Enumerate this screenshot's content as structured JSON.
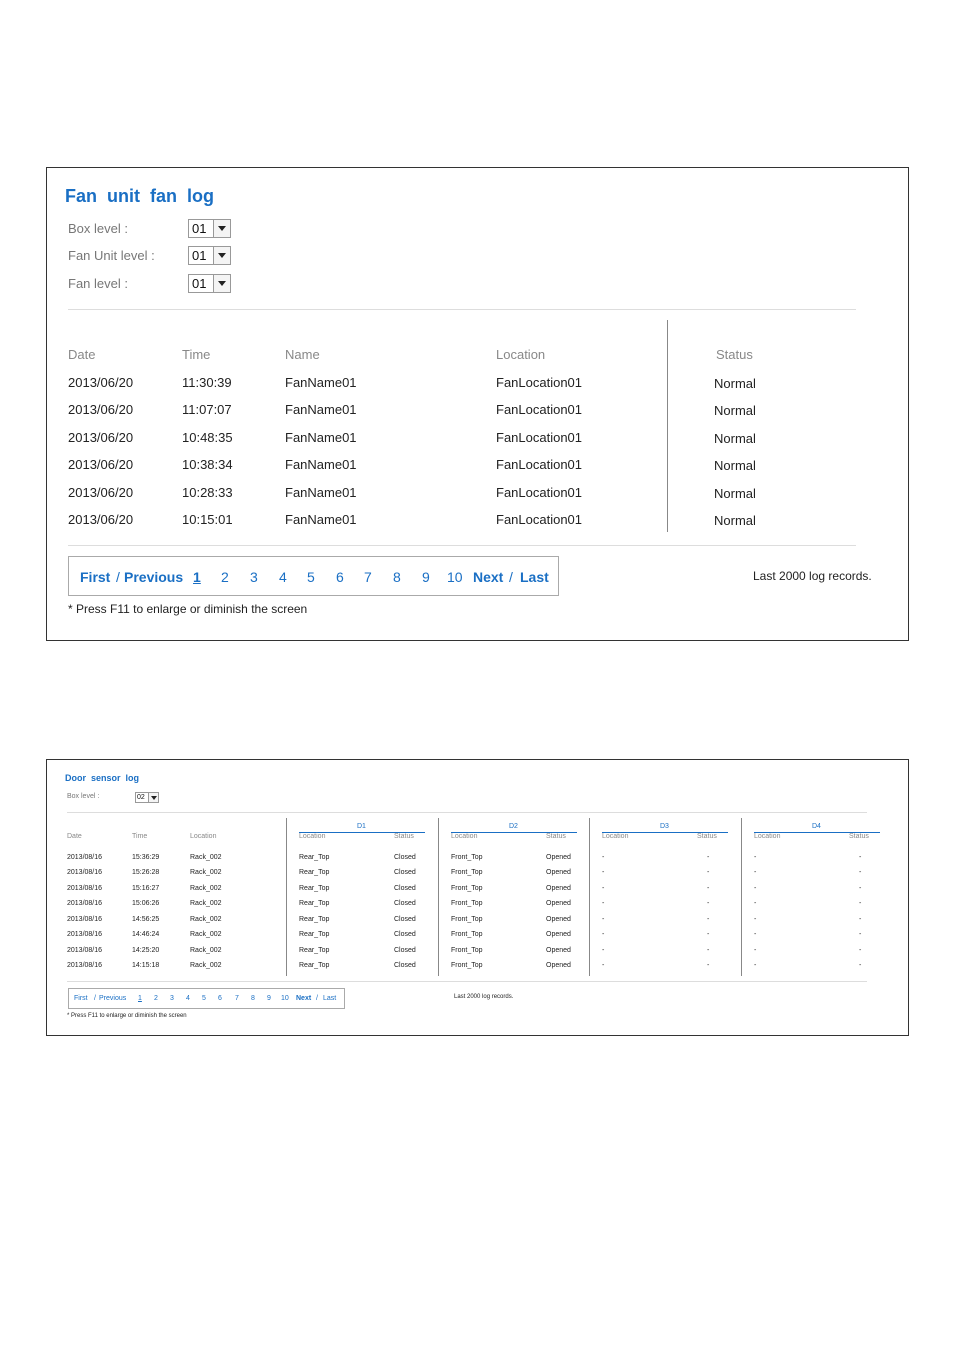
{
  "fan_log": {
    "title": "Fan  unit  fan  log",
    "filters": [
      {
        "label": "Box level :",
        "value": "01"
      },
      {
        "label": "Fan Unit level :",
        "value": "01"
      },
      {
        "label": "Fan level :",
        "value": "01"
      }
    ],
    "columns": [
      "Date",
      "Time",
      "Name",
      "Location",
      "Status"
    ],
    "rows": [
      [
        "2013/06/20",
        "11:30:39",
        "FanName01",
        "FanLocation01",
        "Normal"
      ],
      [
        "2013/06/20",
        "11:07:07",
        "FanName01",
        "FanLocation01",
        "Normal"
      ],
      [
        "2013/06/20",
        "10:48:35",
        "FanName01",
        "FanLocation01",
        "Normal"
      ],
      [
        "2013/06/20",
        "10:38:34",
        "FanName01",
        "FanLocation01",
        "Normal"
      ],
      [
        "2013/06/20",
        "10:28:33",
        "FanName01",
        "FanLocation01",
        "Normal"
      ],
      [
        "2013/06/20",
        "10:15:01",
        "FanName01",
        "FanLocation01",
        "Normal"
      ]
    ],
    "pager": {
      "first": "First",
      "sep1": "/",
      "previous": "Previous",
      "pages": [
        "1",
        "2",
        "3",
        "4",
        "5",
        "6",
        "7",
        "8",
        "9",
        "10"
      ],
      "next": "Next",
      "sep2": "/",
      "last": "Last"
    },
    "records_note": "Last 2000 log records.",
    "hint": "* Press F11 to enlarge or diminish the screen"
  },
  "door_log": {
    "title": "Door  sensor  log",
    "filter": {
      "label": "Box level :",
      "value": "02"
    },
    "columns": [
      "Date",
      "Time",
      "Location"
    ],
    "groups": [
      {
        "name": "D1",
        "sub": [
          "Location",
          "Status"
        ]
      },
      {
        "name": "D2",
        "sub": [
          "Location",
          "Status"
        ]
      },
      {
        "name": "D3",
        "sub": [
          "Location",
          "Status"
        ]
      },
      {
        "name": "D4",
        "sub": [
          "Location",
          "Status"
        ]
      }
    ],
    "rows": [
      [
        "2013/08/16",
        "15:36:29",
        "Rack_002",
        "Rear_Top",
        "Closed",
        "Front_Top",
        "Opened",
        "-",
        "-",
        "-",
        "-"
      ],
      [
        "2013/08/16",
        "15:26:28",
        "Rack_002",
        "Rear_Top",
        "Closed",
        "Front_Top",
        "Opened",
        "-",
        "-",
        "-",
        "-"
      ],
      [
        "2013/08/16",
        "15:16:27",
        "Rack_002",
        "Rear_Top",
        "Closed",
        "Front_Top",
        "Opened",
        "-",
        "-",
        "-",
        "-"
      ],
      [
        "2013/08/16",
        "15:06:26",
        "Rack_002",
        "Rear_Top",
        "Closed",
        "Front_Top",
        "Opened",
        "-",
        "-",
        "-",
        "-"
      ],
      [
        "2013/08/16",
        "14:56:25",
        "Rack_002",
        "Rear_Top",
        "Closed",
        "Front_Top",
        "Opened",
        "-",
        "-",
        "-",
        "-"
      ],
      [
        "2013/08/16",
        "14:46:24",
        "Rack_002",
        "Rear_Top",
        "Closed",
        "Front_Top",
        "Opened",
        "-",
        "-",
        "-",
        "-"
      ],
      [
        "2013/08/16",
        "14:25:20",
        "Rack_002",
        "Rear_Top",
        "Closed",
        "Front_Top",
        "Opened",
        "-",
        "-",
        "-",
        "-"
      ],
      [
        "2013/08/16",
        "14:15:18",
        "Rack_002",
        "Rear_Top",
        "Closed",
        "Front_Top",
        "Opened",
        "-",
        "-",
        "-",
        "-"
      ]
    ],
    "pager": {
      "first": "First",
      "sep1": "/",
      "previous": "Previous",
      "pages": [
        "1",
        "2",
        "3",
        "4",
        "5",
        "6",
        "7",
        "8",
        "9",
        "10"
      ],
      "next": "Next",
      "sep2": "/",
      "last": "Last"
    },
    "records_note": "Last 2000 log records.",
    "hint": "* Press F11 to enlarge or diminish the screen"
  }
}
